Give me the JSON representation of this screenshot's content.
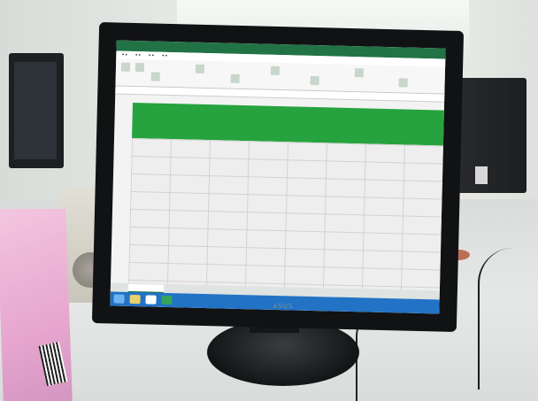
{
  "scene": {
    "subject": "monitor",
    "colors": {
      "spreadsheet_header": "#26a33e",
      "taskbar": "#2273c5",
      "excel_titlebar": "#217346",
      "book_cover": "#e7a7cf"
    }
  },
  "monitor": {
    "brand": "ASUS"
  }
}
